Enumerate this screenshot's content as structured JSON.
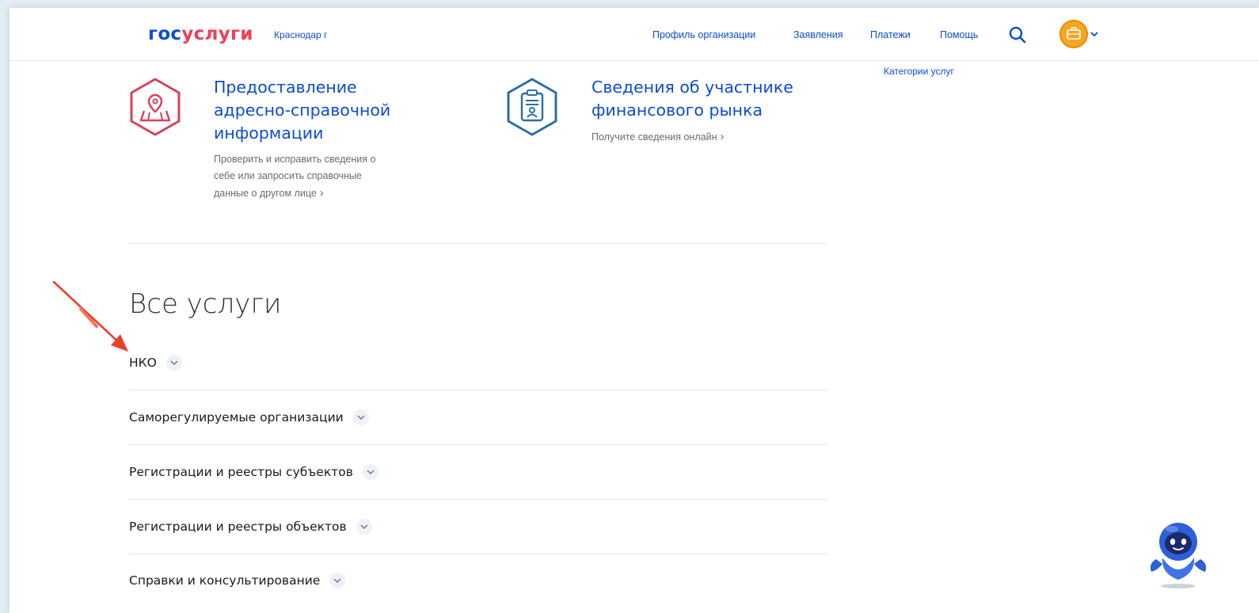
{
  "header": {
    "logo_part1": "гос",
    "logo_part2": "услуги",
    "region": "Краснодар г",
    "nav": [
      {
        "label": "Профиль организации"
      },
      {
        "label": "Заявления"
      },
      {
        "label": "Платежи"
      },
      {
        "label": "Помощь"
      }
    ],
    "search_icon": "search-icon",
    "avatar_icon": "organization-avatar-icon"
  },
  "sidebar": {
    "categories_link": "Категории услуг"
  },
  "cards": [
    {
      "icon": "map-pin-icon",
      "title_lines": [
        "Предоставление",
        "адресно-справочной",
        "информации"
      ],
      "desc_lines": [
        "Проверить и исправить сведения о",
        "себе или запросить справочные",
        "данные о другом лице"
      ]
    },
    {
      "icon": "clipboard-person-icon",
      "title_lines": [
        "Сведения об участнике",
        "финансового рынка"
      ],
      "desc_lines": [
        "Получите сведения онлайн"
      ]
    }
  ],
  "all_services": {
    "title": "Все услуги",
    "categories": [
      {
        "label": "НКО"
      },
      {
        "label": "Саморегулируемые организации"
      },
      {
        "label": "Регистрации и реестры субъектов"
      },
      {
        "label": "Регистрации и реестры объектов"
      },
      {
        "label": "Справки и консультирование"
      }
    ]
  },
  "colors": {
    "brand_blue": "#0d4cd3",
    "brand_red": "#ee3f58",
    "card1_icon": "#d8405c",
    "card2_icon": "#2b6ea8",
    "arrow": "#e8412b"
  },
  "assistant_icon": "robot-assistant-icon"
}
